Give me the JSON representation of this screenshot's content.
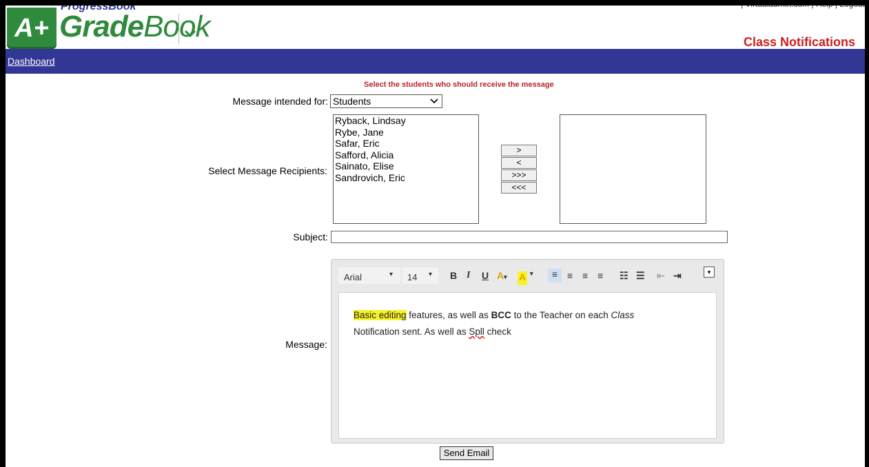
{
  "header": {
    "brand_top": "ProgressBook",
    "brand_main_bold": "Grade",
    "brand_main_rest": "Book",
    "logo_text": "A+",
    "top_links": "| Virtualadmin.com | Help | Logout",
    "page_title": "Class Notifications"
  },
  "nav": {
    "dashboard": "Dashboard"
  },
  "form": {
    "instruction": "Select the students who should receive the message",
    "intended_label": "Message intended for:",
    "intended_value": "Students",
    "recipients_label": "Select Message Recipients:",
    "available_students": [
      "Ryback, Lindsay",
      "Rybe, Jane",
      "Safar, Eric",
      "Safford, Alicia",
      "Sainato, Elise",
      "Sandrovich, Eric"
    ],
    "selected_students": [],
    "move_buttons": [
      ">",
      "<",
      ">>>",
      "<<<"
    ],
    "subject_label": "Subject:",
    "subject_value": "",
    "message_label": "Message:",
    "send_label": "Send Email"
  },
  "editor": {
    "font_name": "Arial",
    "font_size": "14",
    "message_highlight": "Basic editing",
    "message_part1": " features, as well as ",
    "message_bold": "BCC",
    "message_part2": " to the Teacher on each ",
    "message_italic": "Class",
    "message_line2_a": "Notification sent.  As well as ",
    "message_misspelled": "Spll",
    "message_line2_b": " check"
  },
  "colors": {
    "nav_bg": "#323694",
    "title_red": "#cc2020",
    "brand_green": "#2f8a3d",
    "highlight_yellow": "#f7f32a"
  }
}
